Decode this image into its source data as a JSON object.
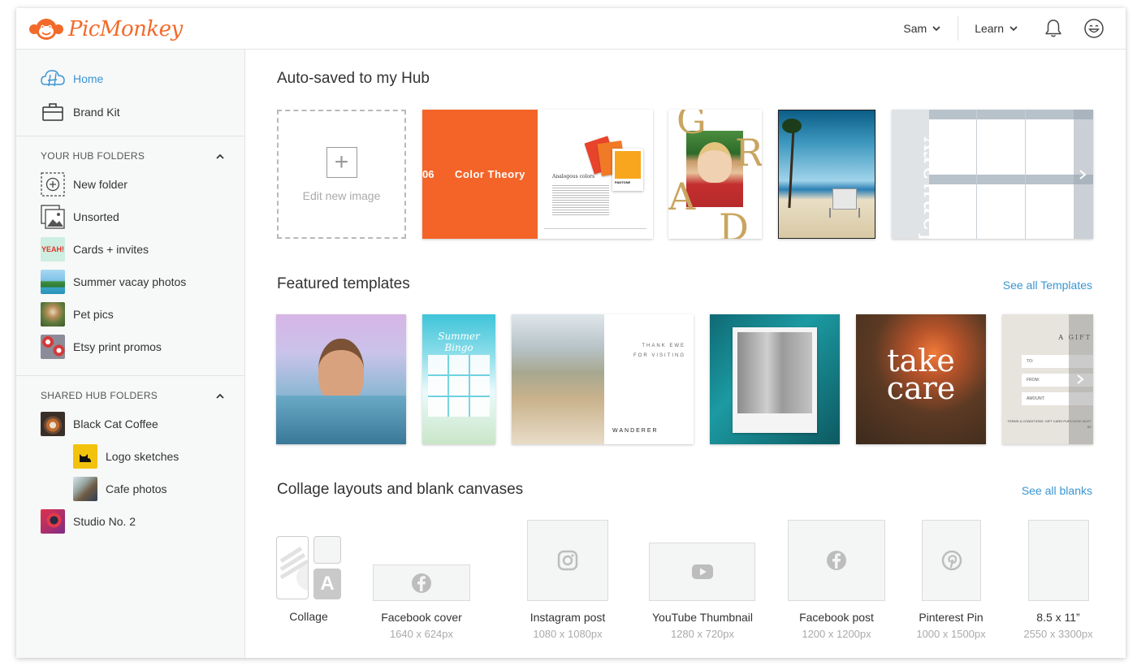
{
  "app": {
    "name": "PicMonkey"
  },
  "header": {
    "user_label": "Sam",
    "learn_label": "Learn",
    "icons": [
      "bell-icon",
      "smiley-face-icon"
    ]
  },
  "sidebar": {
    "home": "Home",
    "brand_kit": "Brand Kit",
    "your_heading": "YOUR HUB FOLDERS",
    "your_items": [
      "New folder",
      "Unsorted",
      "Cards + invites",
      "Summer vacay photos",
      "Pet pics",
      "Etsy print promos"
    ],
    "cards_thumb_text": "YEAH!",
    "shared_heading": "SHARED HUB FOLDERS",
    "shared_items": [
      "Black Cat Coffee",
      "Logo sketches",
      "Cafe photos",
      "Studio No. 2"
    ]
  },
  "autosaved": {
    "title": "Auto-saved to my Hub",
    "edit_new_label": "Edit new image",
    "color_theory": {
      "number": "06",
      "title": "Color Theory",
      "subtitle": "Analogous colors",
      "swatch_label": "PANTONE"
    },
    "grad": {
      "letters": [
        "G",
        "R",
        "A",
        "D"
      ]
    },
    "calendar": {
      "month": "January"
    }
  },
  "featured": {
    "title": "Featured templates",
    "see_all": "See all Templates",
    "wanderer": {
      "line1": "THANK EWE",
      "line2": "FOR VISITING",
      "brand": "WANDERER"
    },
    "bingo": {
      "title": "Summer Bingo"
    },
    "take_care": {
      "line1": "take",
      "line2": "care"
    },
    "gift": {
      "title": "A GIFT",
      "fields": [
        "TO:",
        "FROM:",
        "AMOUNT:"
      ],
      "footer": "TERMS & CONDITIONS. GIFT CARD PURCHASE MUST BE"
    }
  },
  "blanks": {
    "title": "Collage layouts and blank canvases",
    "see_all": "See all blanks",
    "items": [
      {
        "label": "Collage",
        "size": "",
        "icon": "collage-icon"
      },
      {
        "label": "Facebook cover",
        "size": "1640 x 624px",
        "icon": "facebook-icon"
      },
      {
        "label": "Instagram post",
        "size": "1080 x 1080px",
        "icon": "instagram-icon"
      },
      {
        "label": "YouTube Thumbnail",
        "size": "1280 x 720px",
        "icon": "youtube-icon"
      },
      {
        "label": "Facebook post",
        "size": "1200 x 1200px",
        "icon": "facebook-icon"
      },
      {
        "label": "Pinterest Pin",
        "size": "1000 x 1500px",
        "icon": "pinterest-icon"
      },
      {
        "label": "8.5 x 11”",
        "size": "2550 x 3300px",
        "icon": ""
      }
    ]
  },
  "colors": {
    "accent": "#3a95d3",
    "brand": "#f26a2a",
    "sidebar_bg": "#f7f8f8"
  }
}
